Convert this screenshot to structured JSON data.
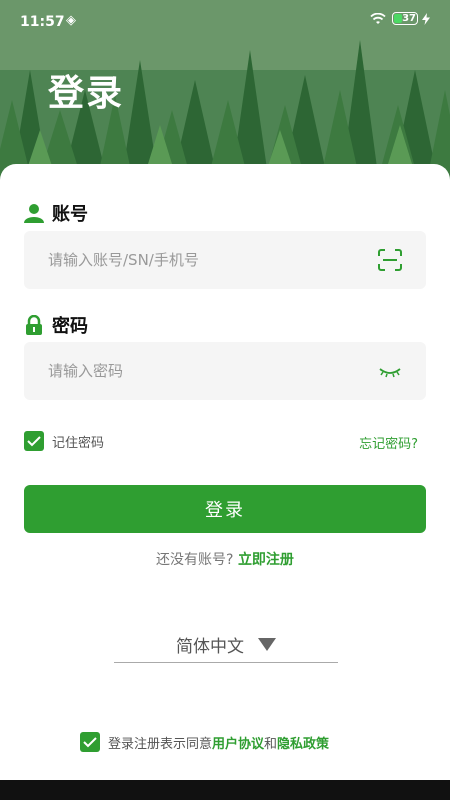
{
  "status_bar": {
    "time": "11:57",
    "battery_level": "37"
  },
  "header": {
    "title": "登录"
  },
  "account": {
    "label": "账号",
    "placeholder": "请输入账号/SN/手机号"
  },
  "password": {
    "label": "密码",
    "placeholder": "请输入密码"
  },
  "remember": {
    "label": "记住密码",
    "checked": true
  },
  "forgot": {
    "label": "忘记密码?"
  },
  "login_button": {
    "label": "登录"
  },
  "register": {
    "prompt": "还没有账号?",
    "link": "立即注册"
  },
  "language": {
    "selected": "简体中文"
  },
  "agreement": {
    "prefix": "登录注册表示同意",
    "terms": "用户协议",
    "and": "和",
    "privacy": "隐私政策",
    "checked": true
  },
  "colors": {
    "accent": "#2f9e31",
    "input_bg": "#f5f5f5"
  },
  "icons": {
    "account": "user-icon",
    "password": "lock-icon",
    "scan": "scan-icon",
    "eye": "eye-closed-icon"
  }
}
